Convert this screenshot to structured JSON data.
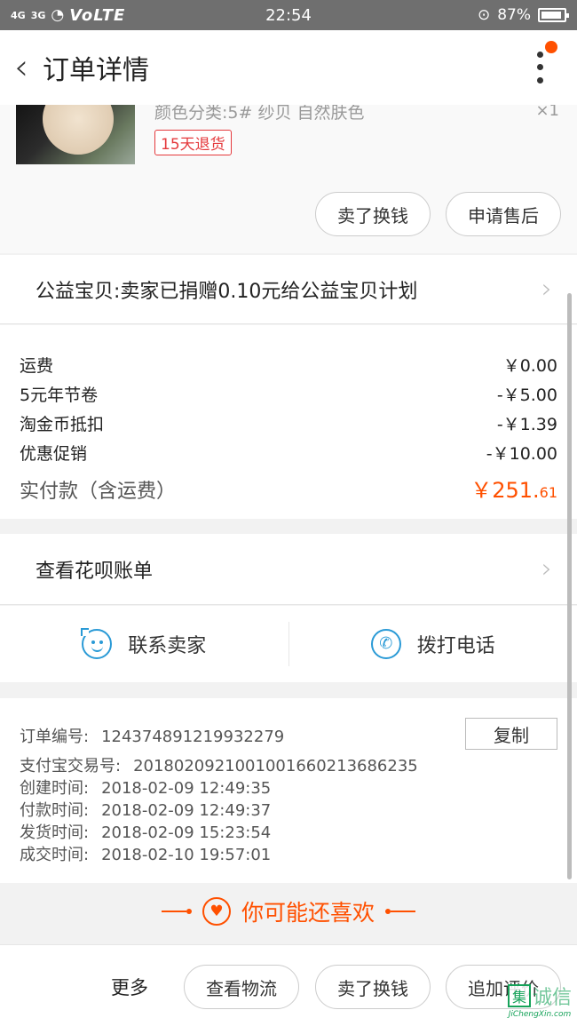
{
  "status_bar": {
    "signal_left": "4G",
    "signal_right": "3G",
    "network": "VoLTE",
    "time": "22:54",
    "battery": "87%"
  },
  "header": {
    "title": "订单详情"
  },
  "product": {
    "sku": "颜色分类:5# 纱贝 自然肤色",
    "qty": "×1",
    "return_tag": "15天退货",
    "actions": [
      "卖了换钱",
      "申请售后"
    ]
  },
  "charity": {
    "text": "公益宝贝:卖家已捐赠0.10元给公益宝贝计划"
  },
  "fees": {
    "rows": [
      {
        "label": "运费",
        "amount": "￥0.00"
      },
      {
        "label": "5元年节卷",
        "amount": "-￥5.00"
      },
      {
        "label": "淘金币抵扣",
        "amount": "-￥1.39"
      },
      {
        "label": "优惠促销",
        "amount": "-￥10.00"
      }
    ],
    "total_label": "实付款（含运费）",
    "total_main": "￥251.",
    "total_decimal": "61"
  },
  "huabei": {
    "label": "查看花呗账单"
  },
  "contact": {
    "seller": "联系卖家",
    "phone": "拨打电话"
  },
  "order_info": {
    "copy_label": "复制",
    "rows": [
      {
        "label": "订单编号:",
        "value": "124374891219932279"
      },
      {
        "label": "支付宝交易号:",
        "value": "2018020921001001660213686235"
      },
      {
        "label": "创建时间:",
        "value": "2018-02-09 12:49:35"
      },
      {
        "label": "付款时间:",
        "value": "2018-02-09 12:49:37"
      },
      {
        "label": "发货时间:",
        "value": "2018-02-09 15:23:54"
      },
      {
        "label": "成交时间:",
        "value": "2018-02-10 19:57:01"
      }
    ]
  },
  "recommend": {
    "text": "你可能还喜欢"
  },
  "bottom_bar": {
    "more": "更多",
    "buttons": [
      "查看物流",
      "卖了换钱",
      "追加评价"
    ]
  },
  "watermark": {
    "box": "集",
    "text": "诚信",
    "url": "JiChengXin.com"
  },
  "colors": {
    "accent": "#ff5000",
    "link_blue": "#2a9ad6",
    "return_red": "#e4393c"
  }
}
